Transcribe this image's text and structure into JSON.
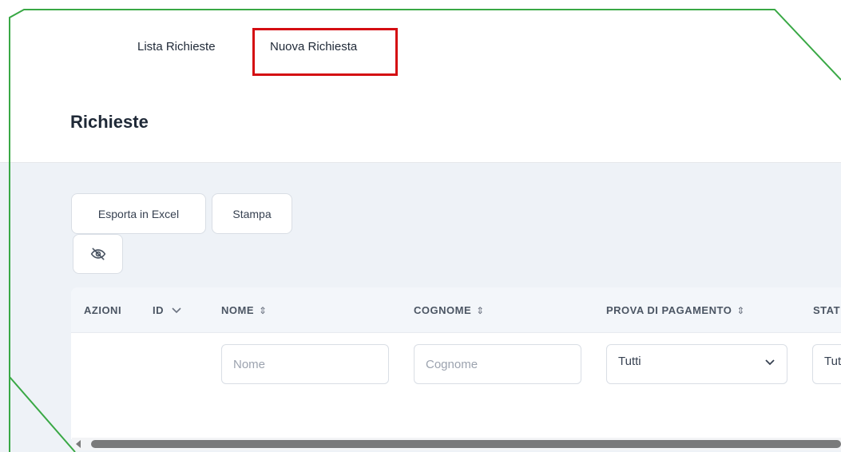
{
  "nav": {
    "items": [
      {
        "label": "Lista Richieste"
      },
      {
        "label": "Nuova Richiesta"
      }
    ]
  },
  "page": {
    "title": "Richieste"
  },
  "toolbar": {
    "export_label": "Esporta in Excel",
    "print_label": "Stampa",
    "visibility_icon": "eye-off-icon"
  },
  "table": {
    "columns": [
      {
        "label": "AZIONI"
      },
      {
        "label": "ID",
        "sort_icon": "chevron-down-icon"
      },
      {
        "label": "NOME",
        "sort_icon": "sort-icon"
      },
      {
        "label": "COGNOME",
        "sort_icon": "sort-icon"
      },
      {
        "label": "PROVA DI PAGAMENTO",
        "sort_icon": "sort-icon"
      },
      {
        "label": "STAT"
      }
    ],
    "filters": {
      "nome_placeholder": "Nome",
      "cognome_placeholder": "Cognome",
      "prova_value": "Tutti",
      "stato_value": "Tut"
    }
  },
  "colors": {
    "highlight": "#d40d12",
    "frame_line": "#39a845",
    "scroll_thumb": "#7a7a7a"
  }
}
